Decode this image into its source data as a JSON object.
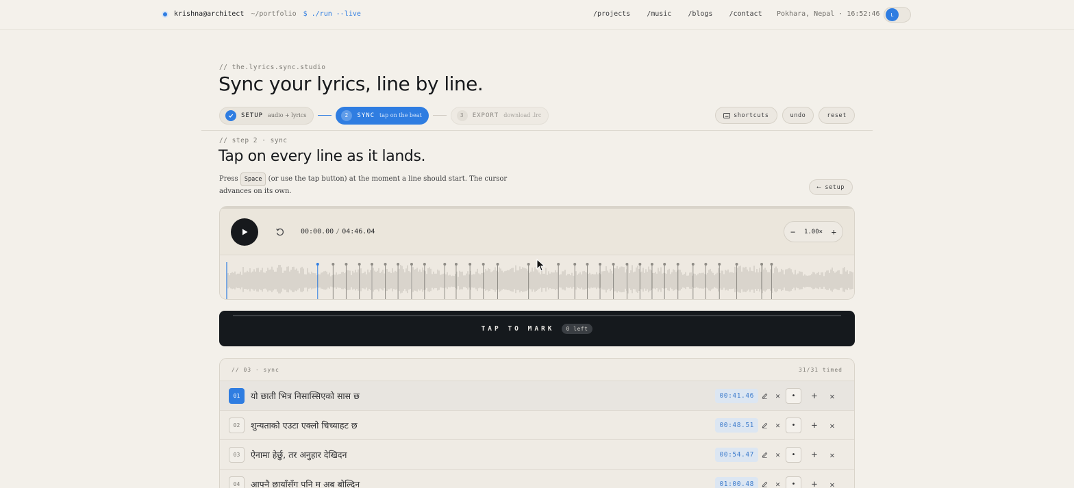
{
  "topbar": {
    "user": "krishna@architect",
    "path": "~/portfolio",
    "command": "$ ./run --live",
    "nav": [
      "/projects",
      "/music",
      "/blogs",
      "/contact"
    ],
    "location": "Pokhara, Nepal · 16:52:46",
    "theme_knob": "L"
  },
  "header": {
    "crumb": "// the.lyrics.sync.studio",
    "title": "Sync your lyrics, line by line."
  },
  "stepper": [
    {
      "num": "✓",
      "label": "SETUP",
      "sub": "audio + lyrics",
      "state": "done"
    },
    {
      "num": "2",
      "label": "SYNC",
      "sub": "tap on the beat",
      "state": "active"
    },
    {
      "num": "3",
      "label": "EXPORT",
      "sub": "download .lrc",
      "state": "todo"
    }
  ],
  "tools": {
    "shortcuts": "shortcuts",
    "undo": "undo",
    "reset": "reset"
  },
  "step": {
    "crumb": "// step 2 · sync",
    "title": "Tap on every line as it lands.",
    "desc_pre": "Press",
    "key": "Space",
    "desc_post": "(or use the tap button) at the moment a line should start. The cursor advances on its own.",
    "back": "⟵ setup"
  },
  "player": {
    "current": "00:00.00",
    "sep": "/",
    "duration": "04:46.04",
    "speed": "1.00×",
    "speed_minus": "−",
    "speed_plus": "+",
    "playhead_fraction": 0.0,
    "markers_seconds": [
      41.46,
      48.51,
      54.47,
      60.48,
      66.2,
      72.3,
      78.1,
      84.3,
      90.2,
      99.4,
      104.6,
      110.9,
      117.0,
      123.5,
      137.6,
      151.2,
      158.7,
      164.4,
      170.2,
      176.3,
      182.5,
      188.4,
      193.9,
      199.6,
      205.7,
      212.6,
      218.4,
      224.6,
      232.5,
      243.9,
      248.4
    ]
  },
  "tap": {
    "label": "TAP TO MARK",
    "badge": "0 left"
  },
  "list": {
    "crumb": "// 03 · sync",
    "count": "31/31 timed",
    "rows": [
      {
        "num": "01",
        "text": "यो छाती भित्र निसास्सिएको सास छ",
        "time": "00:41.46"
      },
      {
        "num": "02",
        "text": "शुन्यताको एउटा एक्लो चिच्याहट छ",
        "time": "00:48.51"
      },
      {
        "num": "03",
        "text": "ऐनामा हेर्छु, तर अनुहार देखिदन",
        "time": "00:54.47"
      },
      {
        "num": "04",
        "text": "आफ्नै छायाँसँग पनि म अब बोल्दिन",
        "time": "01:00.48"
      }
    ]
  },
  "colors": {
    "accent": "#2f7de1",
    "ink": "#15191d",
    "bg": "#f3f0ea"
  }
}
